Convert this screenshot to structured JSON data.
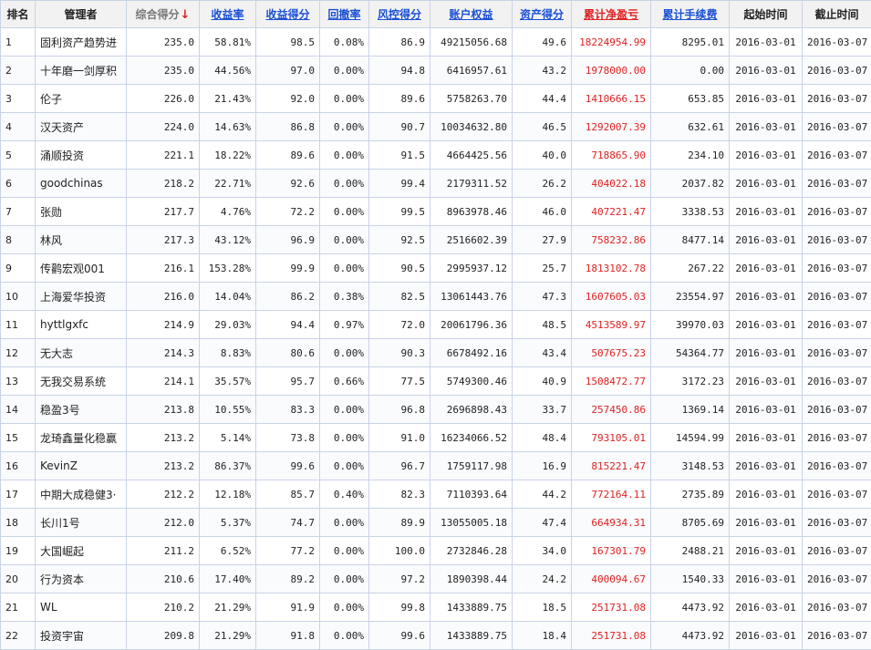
{
  "headers": {
    "rank": "排名",
    "manager": "管理者",
    "score": "综合得分",
    "return_rate": "收益率",
    "return_score": "收益得分",
    "drawdown": "回撤率",
    "risk_score": "风控得分",
    "equity": "账户权益",
    "asset_score": "资产得分",
    "cum_pnl": "累计净盈亏",
    "cum_fee": "累计手续费",
    "start_time": "起始时间",
    "end_time": "截止时间"
  },
  "sort_indicator": "↓",
  "colors": {
    "link": "#1a4fd6",
    "pnl": "#e02020",
    "border": "#c9d3e6",
    "header_bg": "#f2f2f2"
  },
  "rows": [
    {
      "rank": "1",
      "manager": "固利资产趋势进",
      "score": "235.0",
      "return_rate": "58.81%",
      "return_score": "98.5",
      "drawdown": "0.08%",
      "risk_score": "86.9",
      "equity": "49215056.68",
      "asset_score": "49.6",
      "cum_pnl": "18224954.99",
      "cum_fee": "8295.01",
      "start": "2016-03-01",
      "end": "2016-03-07"
    },
    {
      "rank": "2",
      "manager": "十年磨一剑厚积",
      "score": "235.0",
      "return_rate": "44.56%",
      "return_score": "97.0",
      "drawdown": "0.00%",
      "risk_score": "94.8",
      "equity": "6416957.61",
      "asset_score": "43.2",
      "cum_pnl": "1978000.00",
      "cum_fee": "0.00",
      "start": "2016-03-01",
      "end": "2016-03-07"
    },
    {
      "rank": "3",
      "manager": "伦子",
      "score": "226.0",
      "return_rate": "21.43%",
      "return_score": "92.0",
      "drawdown": "0.00%",
      "risk_score": "89.6",
      "equity": "5758263.70",
      "asset_score": "44.4",
      "cum_pnl": "1410666.15",
      "cum_fee": "653.85",
      "start": "2016-03-01",
      "end": "2016-03-07"
    },
    {
      "rank": "4",
      "manager": "汉天资产",
      "score": "224.0",
      "return_rate": "14.63%",
      "return_score": "86.8",
      "drawdown": "0.00%",
      "risk_score": "90.7",
      "equity": "10034632.80",
      "asset_score": "46.5",
      "cum_pnl": "1292007.39",
      "cum_fee": "632.61",
      "start": "2016-03-01",
      "end": "2016-03-07"
    },
    {
      "rank": "5",
      "manager": "涌顺投资",
      "score": "221.1",
      "return_rate": "18.22%",
      "return_score": "89.6",
      "drawdown": "0.00%",
      "risk_score": "91.5",
      "equity": "4664425.56",
      "asset_score": "40.0",
      "cum_pnl": "718865.90",
      "cum_fee": "234.10",
      "start": "2016-03-01",
      "end": "2016-03-07"
    },
    {
      "rank": "6",
      "manager": "goodchinas",
      "score": "218.2",
      "return_rate": "22.71%",
      "return_score": "92.6",
      "drawdown": "0.00%",
      "risk_score": "99.4",
      "equity": "2179311.52",
      "asset_score": "26.2",
      "cum_pnl": "404022.18",
      "cum_fee": "2037.82",
      "start": "2016-03-01",
      "end": "2016-03-07"
    },
    {
      "rank": "7",
      "manager": "张勋",
      "score": "217.7",
      "return_rate": "4.76%",
      "return_score": "72.2",
      "drawdown": "0.00%",
      "risk_score": "99.5",
      "equity": "8963978.46",
      "asset_score": "46.0",
      "cum_pnl": "407221.47",
      "cum_fee": "3338.53",
      "start": "2016-03-01",
      "end": "2016-03-07"
    },
    {
      "rank": "8",
      "manager": "林风",
      "score": "217.3",
      "return_rate": "43.12%",
      "return_score": "96.9",
      "drawdown": "0.00%",
      "risk_score": "92.5",
      "equity": "2516602.39",
      "asset_score": "27.9",
      "cum_pnl": "758232.86",
      "cum_fee": "8477.14",
      "start": "2016-03-01",
      "end": "2016-03-07"
    },
    {
      "rank": "9",
      "manager": "传鹳宏观001",
      "score": "216.1",
      "return_rate": "153.28%",
      "return_score": "99.9",
      "drawdown": "0.00%",
      "risk_score": "90.5",
      "equity": "2995937.12",
      "asset_score": "25.7",
      "cum_pnl": "1813102.78",
      "cum_fee": "267.22",
      "start": "2016-03-01",
      "end": "2016-03-07"
    },
    {
      "rank": "10",
      "manager": "上海爱华投资",
      "score": "216.0",
      "return_rate": "14.04%",
      "return_score": "86.2",
      "drawdown": "0.38%",
      "risk_score": "82.5",
      "equity": "13061443.76",
      "asset_score": "47.3",
      "cum_pnl": "1607605.03",
      "cum_fee": "23554.97",
      "start": "2016-03-01",
      "end": "2016-03-07"
    },
    {
      "rank": "11",
      "manager": "hyttlgxfc",
      "score": "214.9",
      "return_rate": "29.03%",
      "return_score": "94.4",
      "drawdown": "0.97%",
      "risk_score": "72.0",
      "equity": "20061796.36",
      "asset_score": "48.5",
      "cum_pnl": "4513589.97",
      "cum_fee": "39970.03",
      "start": "2016-03-01",
      "end": "2016-03-07"
    },
    {
      "rank": "12",
      "manager": "无大志",
      "score": "214.3",
      "return_rate": "8.83%",
      "return_score": "80.6",
      "drawdown": "0.00%",
      "risk_score": "90.3",
      "equity": "6678492.16",
      "asset_score": "43.4",
      "cum_pnl": "507675.23",
      "cum_fee": "54364.77",
      "start": "2016-03-01",
      "end": "2016-03-07"
    },
    {
      "rank": "13",
      "manager": "无我交易系统",
      "score": "214.1",
      "return_rate": "35.57%",
      "return_score": "95.7",
      "drawdown": "0.66%",
      "risk_score": "77.5",
      "equity": "5749300.46",
      "asset_score": "40.9",
      "cum_pnl": "1508472.77",
      "cum_fee": "3172.23",
      "start": "2016-03-01",
      "end": "2016-03-07"
    },
    {
      "rank": "14",
      "manager": "稳盈3号",
      "score": "213.8",
      "return_rate": "10.55%",
      "return_score": "83.3",
      "drawdown": "0.00%",
      "risk_score": "96.8",
      "equity": "2696898.43",
      "asset_score": "33.7",
      "cum_pnl": "257450.86",
      "cum_fee": "1369.14",
      "start": "2016-03-01",
      "end": "2016-03-07"
    },
    {
      "rank": "15",
      "manager": "龙琦鑫量化稳赢",
      "score": "213.2",
      "return_rate": "5.14%",
      "return_score": "73.8",
      "drawdown": "0.00%",
      "risk_score": "91.0",
      "equity": "16234066.52",
      "asset_score": "48.4",
      "cum_pnl": "793105.01",
      "cum_fee": "14594.99",
      "start": "2016-03-01",
      "end": "2016-03-07"
    },
    {
      "rank": "16",
      "manager": "KevinZ",
      "score": "213.2",
      "return_rate": "86.37%",
      "return_score": "99.6",
      "drawdown": "0.00%",
      "risk_score": "96.7",
      "equity": "1759117.98",
      "asset_score": "16.9",
      "cum_pnl": "815221.47",
      "cum_fee": "3148.53",
      "start": "2016-03-01",
      "end": "2016-03-07"
    },
    {
      "rank": "17",
      "manager": "中期大成稳健3·",
      "score": "212.2",
      "return_rate": "12.18%",
      "return_score": "85.7",
      "drawdown": "0.40%",
      "risk_score": "82.3",
      "equity": "7110393.64",
      "asset_score": "44.2",
      "cum_pnl": "772164.11",
      "cum_fee": "2735.89",
      "start": "2016-03-01",
      "end": "2016-03-07"
    },
    {
      "rank": "18",
      "manager": "长川1号",
      "score": "212.0",
      "return_rate": "5.37%",
      "return_score": "74.7",
      "drawdown": "0.00%",
      "risk_score": "89.9",
      "equity": "13055005.18",
      "asset_score": "47.4",
      "cum_pnl": "664934.31",
      "cum_fee": "8705.69",
      "start": "2016-03-01",
      "end": "2016-03-07"
    },
    {
      "rank": "19",
      "manager": "大国崛起",
      "score": "211.2",
      "return_rate": "6.52%",
      "return_score": "77.2",
      "drawdown": "0.00%",
      "risk_score": "100.0",
      "equity": "2732846.28",
      "asset_score": "34.0",
      "cum_pnl": "167301.79",
      "cum_fee": "2488.21",
      "start": "2016-03-01",
      "end": "2016-03-07"
    },
    {
      "rank": "20",
      "manager": "行为资本",
      "score": "210.6",
      "return_rate": "17.40%",
      "return_score": "89.2",
      "drawdown": "0.00%",
      "risk_score": "97.2",
      "equity": "1890398.44",
      "asset_score": "24.2",
      "cum_pnl": "400094.67",
      "cum_fee": "1540.33",
      "start": "2016-03-01",
      "end": "2016-03-07"
    },
    {
      "rank": "21",
      "manager": "WL",
      "score": "210.2",
      "return_rate": "21.29%",
      "return_score": "91.9",
      "drawdown": "0.00%",
      "risk_score": "99.8",
      "equity": "1433889.75",
      "asset_score": "18.5",
      "cum_pnl": "251731.08",
      "cum_fee": "4473.92",
      "start": "2016-03-01",
      "end": "2016-03-07"
    },
    {
      "rank": "22",
      "manager": "投资宇宙",
      "score": "209.8",
      "return_rate": "21.29%",
      "return_score": "91.8",
      "drawdown": "0.00%",
      "risk_score": "99.6",
      "equity": "1433889.75",
      "asset_score": "18.4",
      "cum_pnl": "251731.08",
      "cum_fee": "4473.92",
      "start": "2016-03-01",
      "end": "2016-03-07"
    }
  ]
}
